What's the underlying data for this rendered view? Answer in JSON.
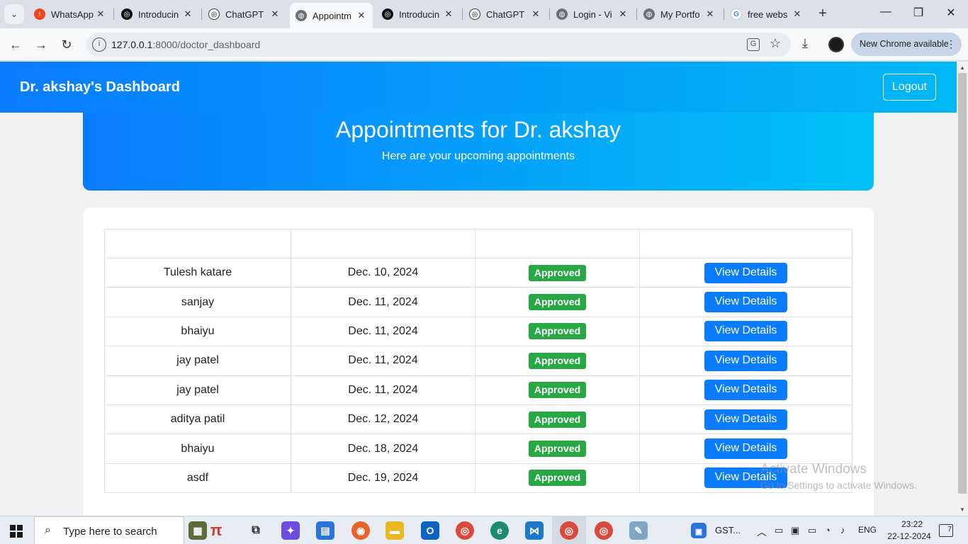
{
  "browser": {
    "tabs": [
      {
        "label": "WhatsApp",
        "icon": "whatsapp-alert-icon"
      },
      {
        "label": "Introducin",
        "icon": "openai-icon"
      },
      {
        "label": "ChatGPT",
        "icon": "openai-icon"
      },
      {
        "label": "Appointm",
        "icon": "globe-icon",
        "active": true
      },
      {
        "label": "Introducin",
        "icon": "openai-icon"
      },
      {
        "label": "ChatGPT",
        "icon": "openai-icon"
      },
      {
        "label": "Login - Vi",
        "icon": "globe-icon"
      },
      {
        "label": "My Portfo",
        "icon": "globe-icon"
      },
      {
        "label": "free webs",
        "icon": "google-icon"
      }
    ],
    "url_host": "127.0.0.1",
    "url_path": ":8000/doctor_dashboard",
    "update_pill": "New Chrome available"
  },
  "page": {
    "header_title": "Dr. akshay's Dashboard",
    "logout_label": "Logout",
    "hero_title": "Appointments for Dr. akshay",
    "hero_subtitle": "Here are your upcoming appointments",
    "table": {
      "headers": [
        "",
        "",
        "",
        ""
      ],
      "rows": [
        {
          "patient": "Tulesh katare",
          "date": "Dec. 10, 2024",
          "status": "Approved",
          "action": "View Details"
        },
        {
          "patient": "sanjay",
          "date": "Dec. 11, 2024",
          "status": "Approved",
          "action": "View Details"
        },
        {
          "patient": "bhaiyu",
          "date": "Dec. 11, 2024",
          "status": "Approved",
          "action": "View Details"
        },
        {
          "patient": "jay patel",
          "date": "Dec. 11, 2024",
          "status": "Approved",
          "action": "View Details"
        },
        {
          "patient": "jay patel",
          "date": "Dec. 11, 2024",
          "status": "Approved",
          "action": "View Details"
        },
        {
          "patient": "aditya patil",
          "date": "Dec. 12, 2024",
          "status": "Approved",
          "action": "View Details"
        },
        {
          "patient": "bhaiyu",
          "date": "Dec. 18, 2024",
          "status": "Approved",
          "action": "View Details"
        },
        {
          "patient": "asdf",
          "date": "Dec. 19, 2024",
          "status": "Approved",
          "action": "View Details"
        }
      ]
    },
    "colors": {
      "header_start": "#0a7cff",
      "header_end": "#00b8f5",
      "badge": "#28a745",
      "button": "#0a7cff"
    }
  },
  "watermark": {
    "line1": "Activate Windows",
    "line2": "Go to Settings to activate Windows."
  },
  "taskbar": {
    "search_placeholder": "Type here to search",
    "pinned_label": "GST...",
    "language": "ENG",
    "time": "23:22",
    "date": "22-12-2024",
    "notifications": "7"
  }
}
